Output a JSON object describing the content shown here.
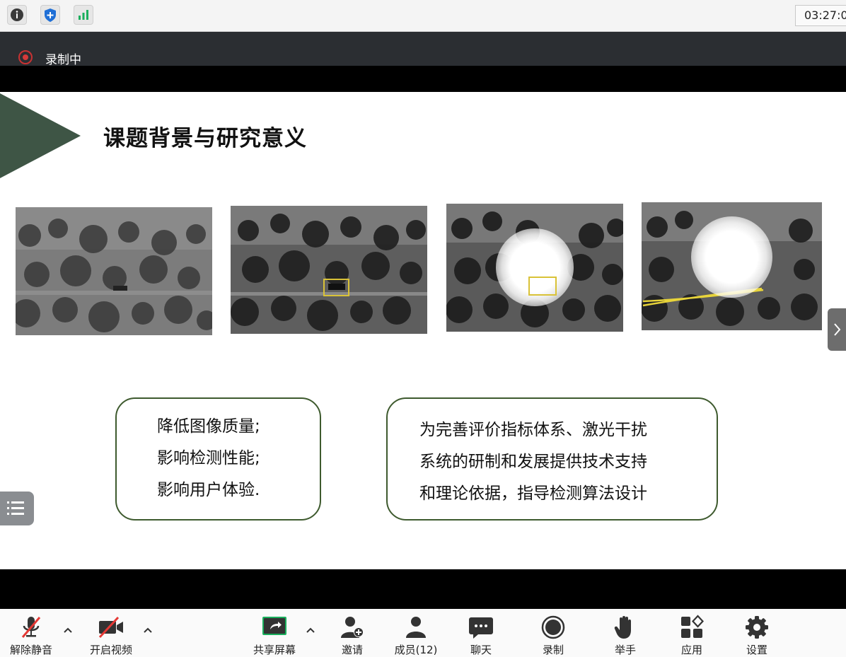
{
  "topbar": {
    "icons": [
      "info-icon",
      "shield-plus-icon",
      "signal-bars-icon"
    ],
    "clock": "03:27:0"
  },
  "recording": {
    "label": "录制中",
    "color": "#d43a3a"
  },
  "slide": {
    "title": "课题背景与研究意义",
    "accent_color": "#3e5545",
    "left_card": {
      "lines": [
        "降低图像质量;",
        "影响检测性能;",
        "影响用户体验."
      ]
    },
    "right_card": {
      "lines": [
        "为完善评价指标体系、激光干扰",
        "系统的研制和发展提供技术支持",
        "和理论依据，指导检测算法设计"
      ]
    },
    "images": [
      "infrared-scene-original",
      "infrared-scene-target-boxed",
      "infrared-scene-laser-glare",
      "infrared-scene-laser-saturated"
    ]
  },
  "toolbar": {
    "mute": "解除静音",
    "video": "开启视频",
    "share": "共享屏幕",
    "invite": "邀请",
    "members": "成员(12)",
    "chat": "聊天",
    "record": "录制",
    "raise_hand": "举手",
    "apps": "应用",
    "settings": "设置",
    "share_color": "#1aaf5d",
    "mute_slash_color": "#e53935"
  }
}
